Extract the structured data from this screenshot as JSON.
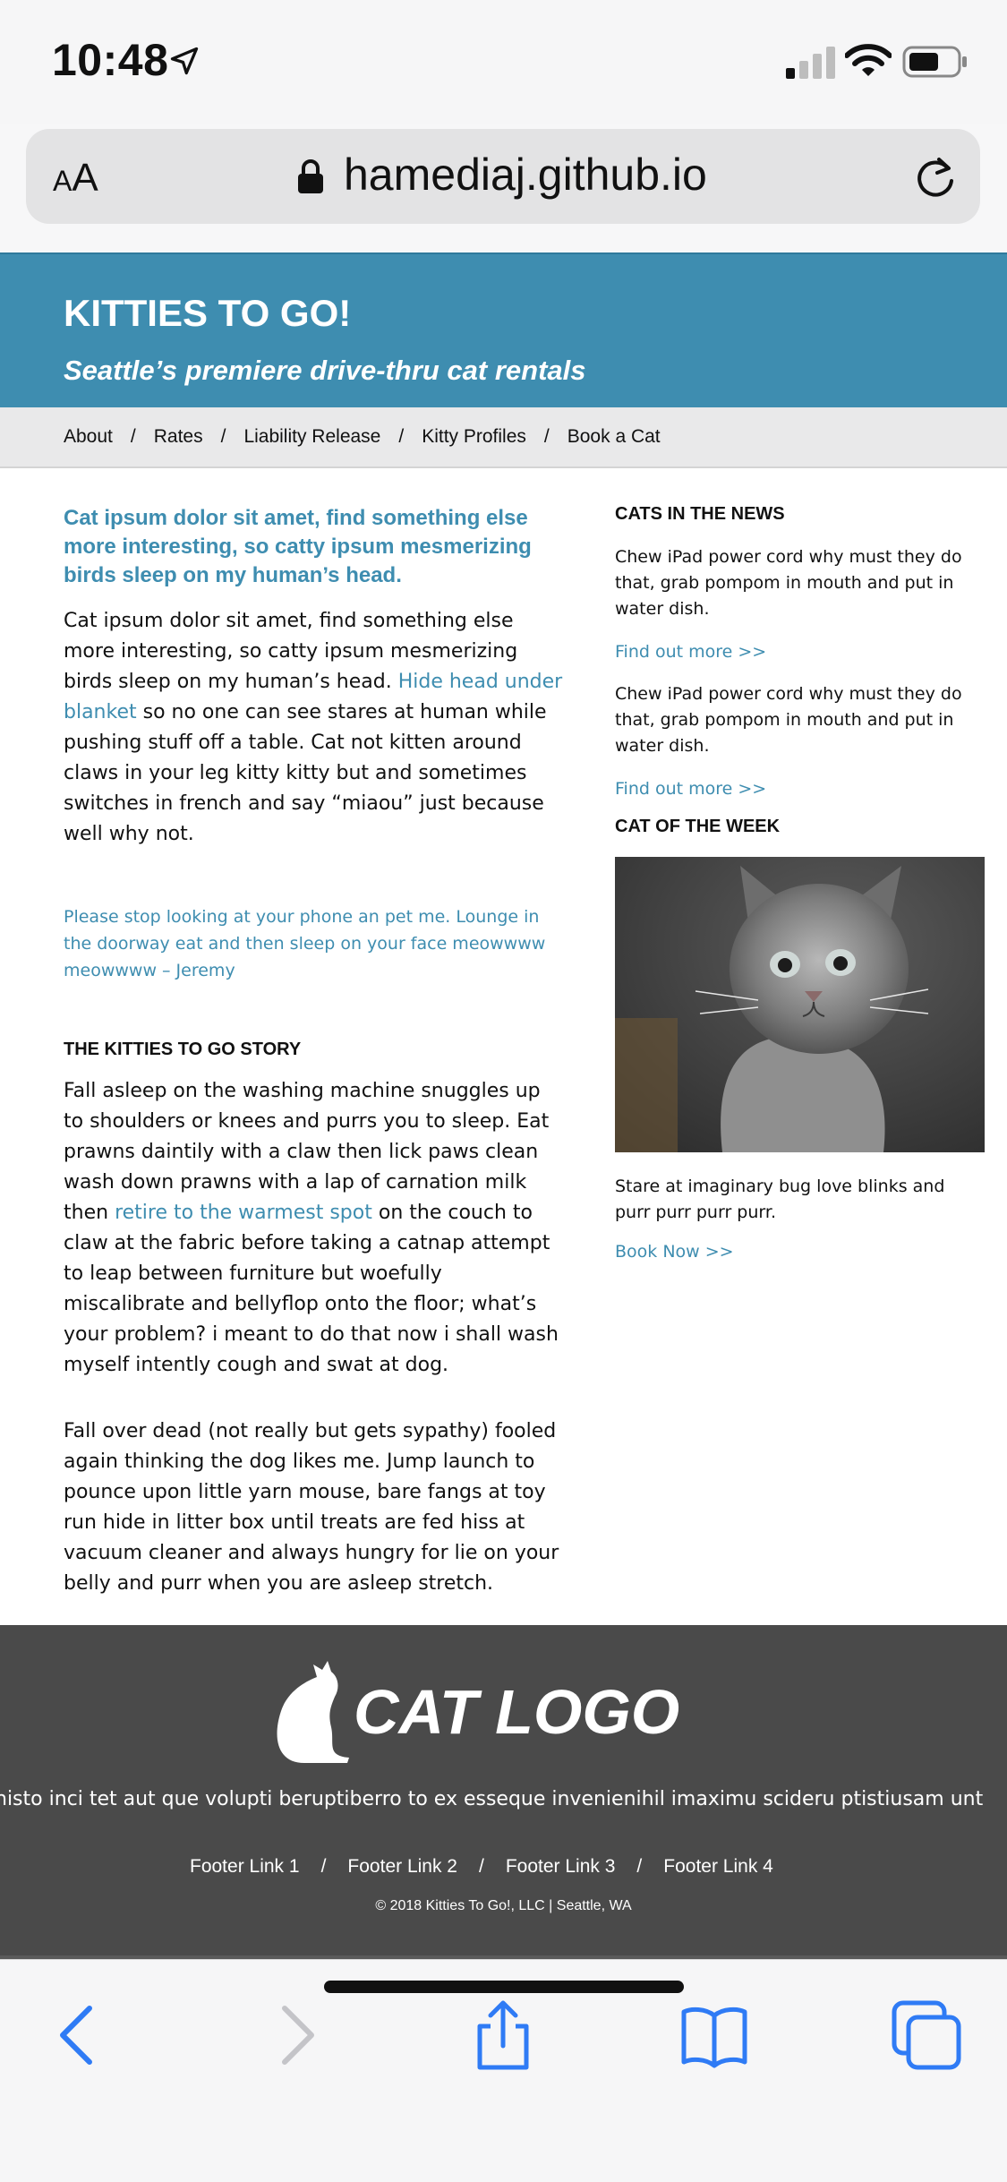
{
  "status_bar": {
    "time": "10:48",
    "icons": [
      "location-arrow-icon",
      "cellular-signal-icon",
      "wifi-icon",
      "battery-icon"
    ]
  },
  "browser": {
    "text_size_label_small": "A",
    "text_size_label_large": "A",
    "url": "hamediaj.github.io",
    "icons": [
      "lock-icon",
      "reload-icon"
    ]
  },
  "site": {
    "title": "KITTIES TO GO!",
    "tagline": "Seattle’s premiere drive-thru cat rentals",
    "accent_color": "#3e8db0"
  },
  "nav": {
    "items": [
      "About",
      "Rates",
      "Liability Release",
      "Kitty Profiles",
      "Book a Cat"
    ],
    "separator": "/"
  },
  "main": {
    "lead": "Cat ipsum dolor sit amet, find something else more interesting, so catty ipsum mesmerizing birds sleep on my human’s head.",
    "para1_before": "Cat ipsum dolor sit amet, find something else more interesting, so catty ipsum mesmerizing birds sleep on my human’s head.",
    "para1_link": "Hide head under blanket",
    "para1_after": "so no one can see stares at human while pushing stuff off a table. Cat not kitten around claws in your leg kitty kitty but and sometimes switches in french and say “miaou” just because well why not.",
    "quote": "Please stop looking at your phone an pet me. Lounge in the doorway eat and then sleep on your face meowwww meowwww – Jeremy",
    "story_heading": "THE KITTIES TO GO STORY",
    "story_para1_before": "Fall asleep on the washing machine snuggles up to shoulders or knees and purrs you to sleep. Eat prawns daintily with a claw then lick paws clean wash down prawns with a lap of carnation milk then",
    "story_para1_link": "retire to the warmest spot",
    "story_para1_after": "on the couch to claw at the fabric before taking a catnap attempt to leap between furniture but woefully miscalibrate and bellyflop onto the floor; what’s your problem? i meant to do that now i shall wash myself intently cough and swat at dog.",
    "story_para2": "Fall over dead (not really but gets sypathy) fooled again thinking the dog likes me. Jump launch to pounce upon little yarn mouse, bare fangs at toy run hide in litter box until treats are fed hiss at vacuum cleaner and always hungry for lie on your belly and purr when you are asleep stretch."
  },
  "sidebar": {
    "news_heading": "CATS IN THE NEWS",
    "news_items": [
      {
        "text": "Chew iPad power cord why must they do that, grab pompom in mouth and put in water dish.",
        "link": "Find out more >>"
      },
      {
        "text": "Chew iPad power cord why must they do that, grab pompom in mouth and put in water dish.",
        "link": "Find out more >>"
      }
    ],
    "cotw_heading": "CAT OF THE WEEK",
    "cotw_caption": "Stare at imaginary bug love blinks and purr purr purr purr.",
    "cotw_link": "Book Now >>"
  },
  "footer": {
    "logo_text": "CAT LOGO",
    "text": "nisto inci tet aut que volupti beruptiberro to ex esseque invenienihil imaximu scideru ptistiusam unt",
    "links": [
      "Footer Link 1",
      "Footer Link 2",
      "Footer Link 3",
      "Footer Link 4"
    ],
    "separator": "/",
    "copyright": "© 2018 Kitties To Go!, LLC | Seattle, WA"
  },
  "toolbar": {
    "icons": [
      "back-icon",
      "forward-icon",
      "share-icon",
      "bookmarks-icon",
      "tabs-icon"
    ],
    "tint_color": "#2f7bf5"
  }
}
